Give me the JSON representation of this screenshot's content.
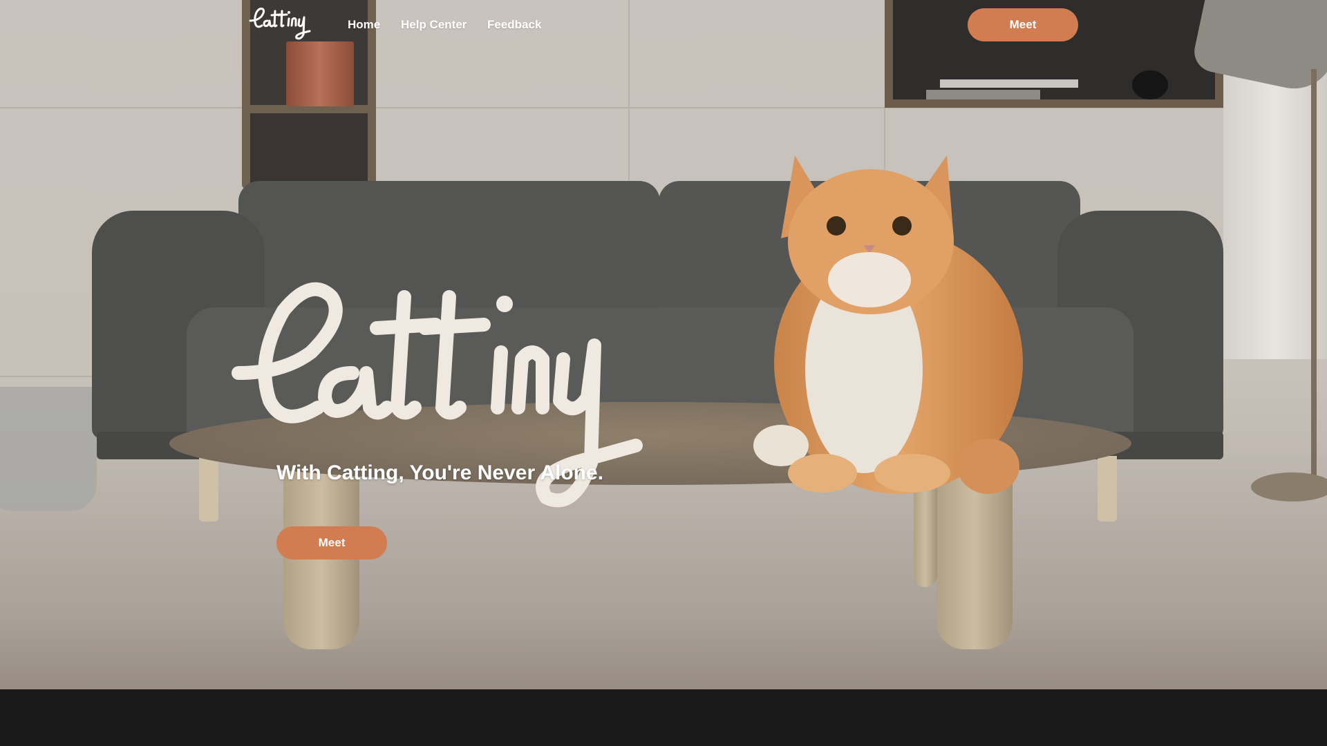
{
  "brand": {
    "logo_text": "Catting",
    "accent": "#d27c52"
  },
  "nav": {
    "links": [
      "Home",
      "Help Center",
      "Feedback"
    ],
    "cta_label": "Meet"
  },
  "hero": {
    "tagline": "With Catting, You're Never Alone.",
    "cta_label": "Meet",
    "image": "cat sitting on wooden coffee table in front of grey sofa in living room"
  },
  "footer": {
    "background": "#1a1a1b"
  }
}
